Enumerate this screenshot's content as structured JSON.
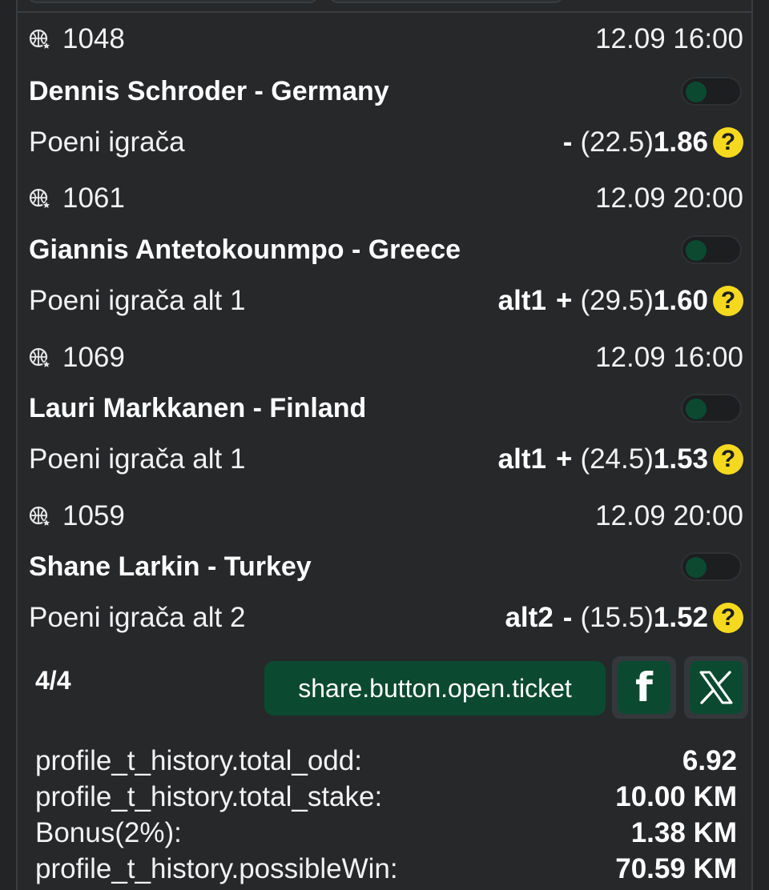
{
  "tickets": [
    {
      "id": "1048",
      "datetime": "12.09 16:00",
      "player": "Dennis Schroder - Germany",
      "market": "Poeni igrača",
      "alt": "",
      "sign": "-",
      "line": "(22.5)",
      "odd": "1.86",
      "toggle_on": false
    },
    {
      "id": "1061",
      "datetime": "12.09 20:00",
      "player": "Giannis Antetokounmpo - Greece",
      "market": "Poeni igrača alt 1",
      "alt": "alt1",
      "sign": "+",
      "line": "(29.5)",
      "odd": "1.60",
      "toggle_on": false
    },
    {
      "id": "1069",
      "datetime": "12.09 16:00",
      "player": "Lauri Markkanen - Finland",
      "market": "Poeni igrača alt 1",
      "alt": "alt1",
      "sign": "+",
      "line": "(24.5)",
      "odd": "1.53",
      "toggle_on": false
    },
    {
      "id": "1059",
      "datetime": "12.09 20:00",
      "player": "Shane Larkin - Turkey",
      "market": "Poeni igrača alt 2",
      "alt": "alt2",
      "sign": "-",
      "line": "(15.5)",
      "odd": "1.52",
      "toggle_on": false
    }
  ],
  "help_glyph": "?",
  "footer": {
    "count": "4/4",
    "open_ticket_label": "share.button.open.ticket",
    "facebook_glyph": "f"
  },
  "summary": {
    "total_odd_label": "profile_t_history.total_odd:",
    "total_odd_value": "6.92",
    "total_stake_label": "profile_t_history.total_stake:",
    "total_stake_value": "10.00 KM",
    "bonus_label": "Bonus(2%):",
    "bonus_value": "1.38 KM",
    "possible_win_label": "profile_t_history.possibleWin:",
    "possible_win_value": "70.59 KM"
  },
  "colors": {
    "background": "#26282a",
    "accent_green": "#0b4a31",
    "help_yellow": "#f5d91e"
  },
  "icons": {
    "sport": "basketball-star-icon",
    "help": "question-icon",
    "facebook": "facebook-icon",
    "x": "x-logo-icon"
  }
}
